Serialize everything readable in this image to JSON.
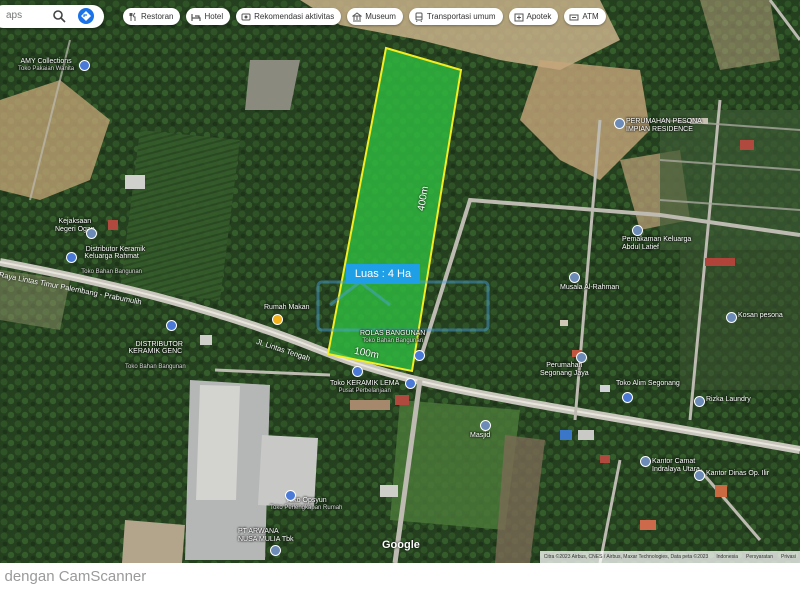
{
  "search": {
    "placeholder_text": "aps"
  },
  "chips": [
    {
      "label": "Restoran",
      "icon": "restaurant-icon"
    },
    {
      "label": "Hotel",
      "icon": "hotel-icon"
    },
    {
      "label": "Rekomendasi aktivitas",
      "icon": "activity-icon"
    },
    {
      "label": "Museum",
      "icon": "museum-icon"
    },
    {
      "label": "Transportasi umum",
      "icon": "transit-icon"
    },
    {
      "label": "Apotek",
      "icon": "pharmacy-icon"
    },
    {
      "label": "ATM",
      "icon": "atm-icon"
    }
  ],
  "places": {
    "amy": {
      "name": "AMY Collections",
      "sub": "Toko Pakaian Wanita"
    },
    "kejaksaan": {
      "name": "Kejaksaan\nNegeri Ogan"
    },
    "distributor_rahmat": {
      "name": "Distributor Keramik\nKeluarga Rahmat",
      "sub": "Toko Bahan Bangunan"
    },
    "distributor_genc": {
      "name": "DISTRIBUTOR\nKERAMIK GENC",
      "sub": "Toko Bahan Bangunan"
    },
    "rumah_makan": {
      "name": "Rumah Makan"
    },
    "rolas": {
      "name": "ROLAS BANGUNAN",
      "sub": "Toko Bahan Bangunan"
    },
    "toko_keramik": {
      "name": "Toko KERAMIK LEMA",
      "sub": "Pusat Perbelanjaan"
    },
    "perumahan_pesona": {
      "name": "PERUMAHAN PESONA\nIMPIAN RESIDENCE"
    },
    "pemakaman": {
      "name": "Pemakaman Keluarga\nAbdul Latief"
    },
    "musala": {
      "name": "Musala Al-Rahman"
    },
    "kosan": {
      "name": "Kosan pesona"
    },
    "perumahan_segonang": {
      "name": "Perumahan\nSegonang Jaya"
    },
    "toko_alim": {
      "name": "Toko Alim Segonang"
    },
    "rizka": {
      "name": "Rizka Laundry"
    },
    "masjid": {
      "name": "Masjid"
    },
    "kantor_camat": {
      "name": "Kantor Camat\nIndralaya Utara"
    },
    "kantor_dinas": {
      "name": "Kantor Dinas Op. Ilir"
    },
    "toko_opsyun": {
      "name": "Toko Opsyun",
      "sub": "Toko Perlengkapan Rumah"
    },
    "arwana": {
      "name": "PT ARWANA\nNUSA MULIA Tbk"
    }
  },
  "roads": {
    "main": "Raya Lintas Timur Palembang - Prabumulih",
    "tengah": "Jl. Lintas Tengah"
  },
  "plot": {
    "area_label": "Luas : 4 Ha",
    "length_label": "400m",
    "width_label": "100m",
    "outline_color": "#f2ee1f",
    "fill_color": "#2fb63e"
  },
  "map": {
    "logo_text": "Google",
    "attribution": [
      "Citra ©2023 Airbus, CNES / Airbus, Maxar Technologies, Data peta ©2023",
      "Indonesia",
      "Persyaratan",
      "Privasi"
    ]
  },
  "watermark": "i dengan CamScanner"
}
